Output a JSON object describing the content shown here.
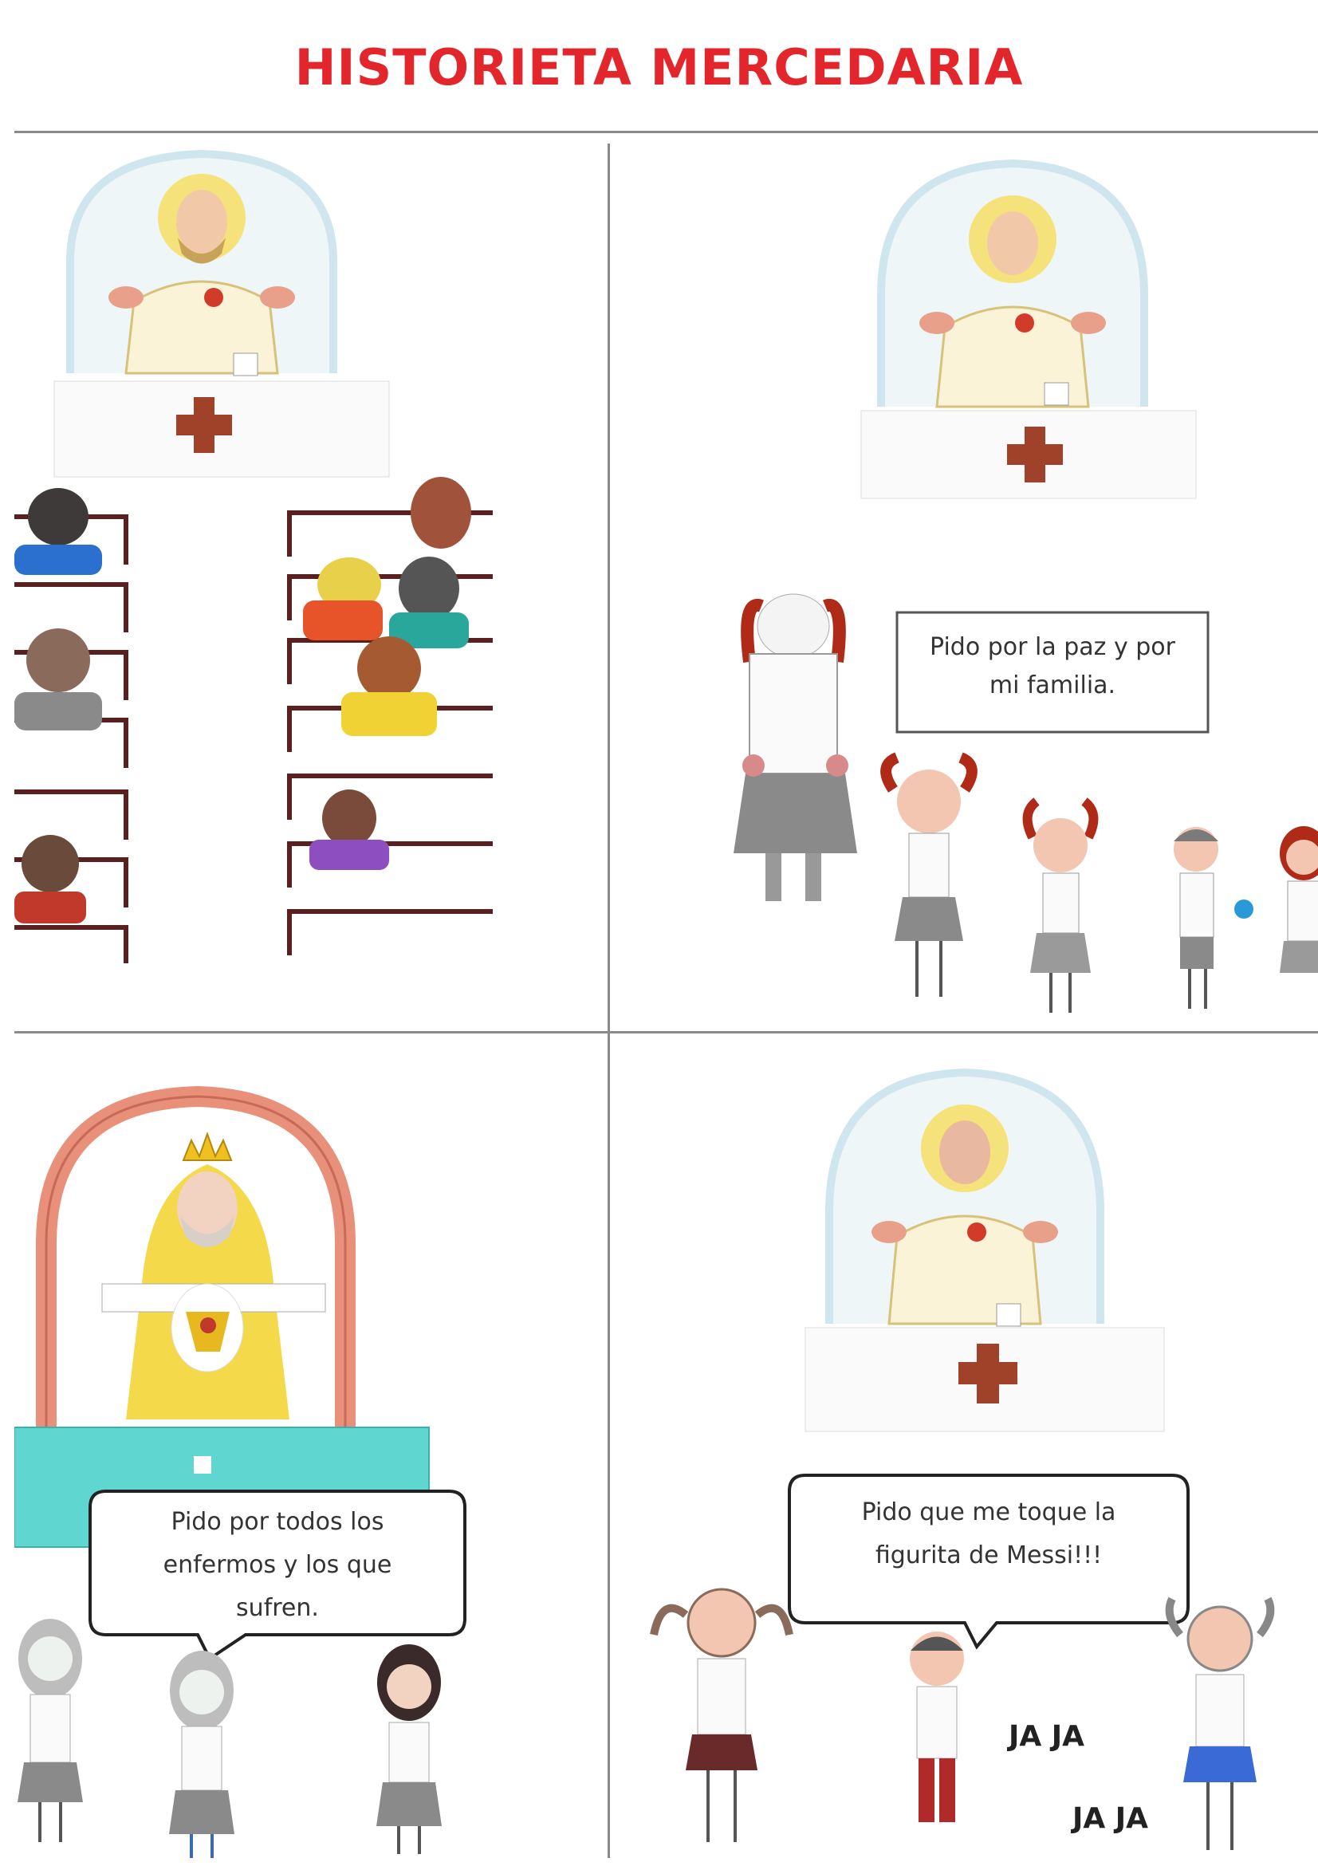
{
  "header": {
    "title": "HISTORIETA MERCEDARIA"
  },
  "panels": [
    {
      "id": "church-pews",
      "caption": ""
    },
    {
      "id": "prayer-peace",
      "speech": "Pido por la paz y por\nmi familia."
    },
    {
      "id": "prayer-sick",
      "speech": "Pido por todos los\nenfermos y los que\nsufren."
    },
    {
      "id": "prayer-messi",
      "speech": "Pido que me toque la\nfigurita de Messi!!!",
      "laugh_1": "JA JA",
      "laugh_2": "JA JA"
    }
  ],
  "colors": {
    "title": "#e3262b",
    "cross": "#a0412a",
    "halo": "#cfe6ee",
    "robe_yellow": "#f4d94a",
    "altar_teal": "#5fd6cf",
    "arch_pink": "#e8907a",
    "pew": "#5a1f1f",
    "hair_red": "#b02a18"
  }
}
